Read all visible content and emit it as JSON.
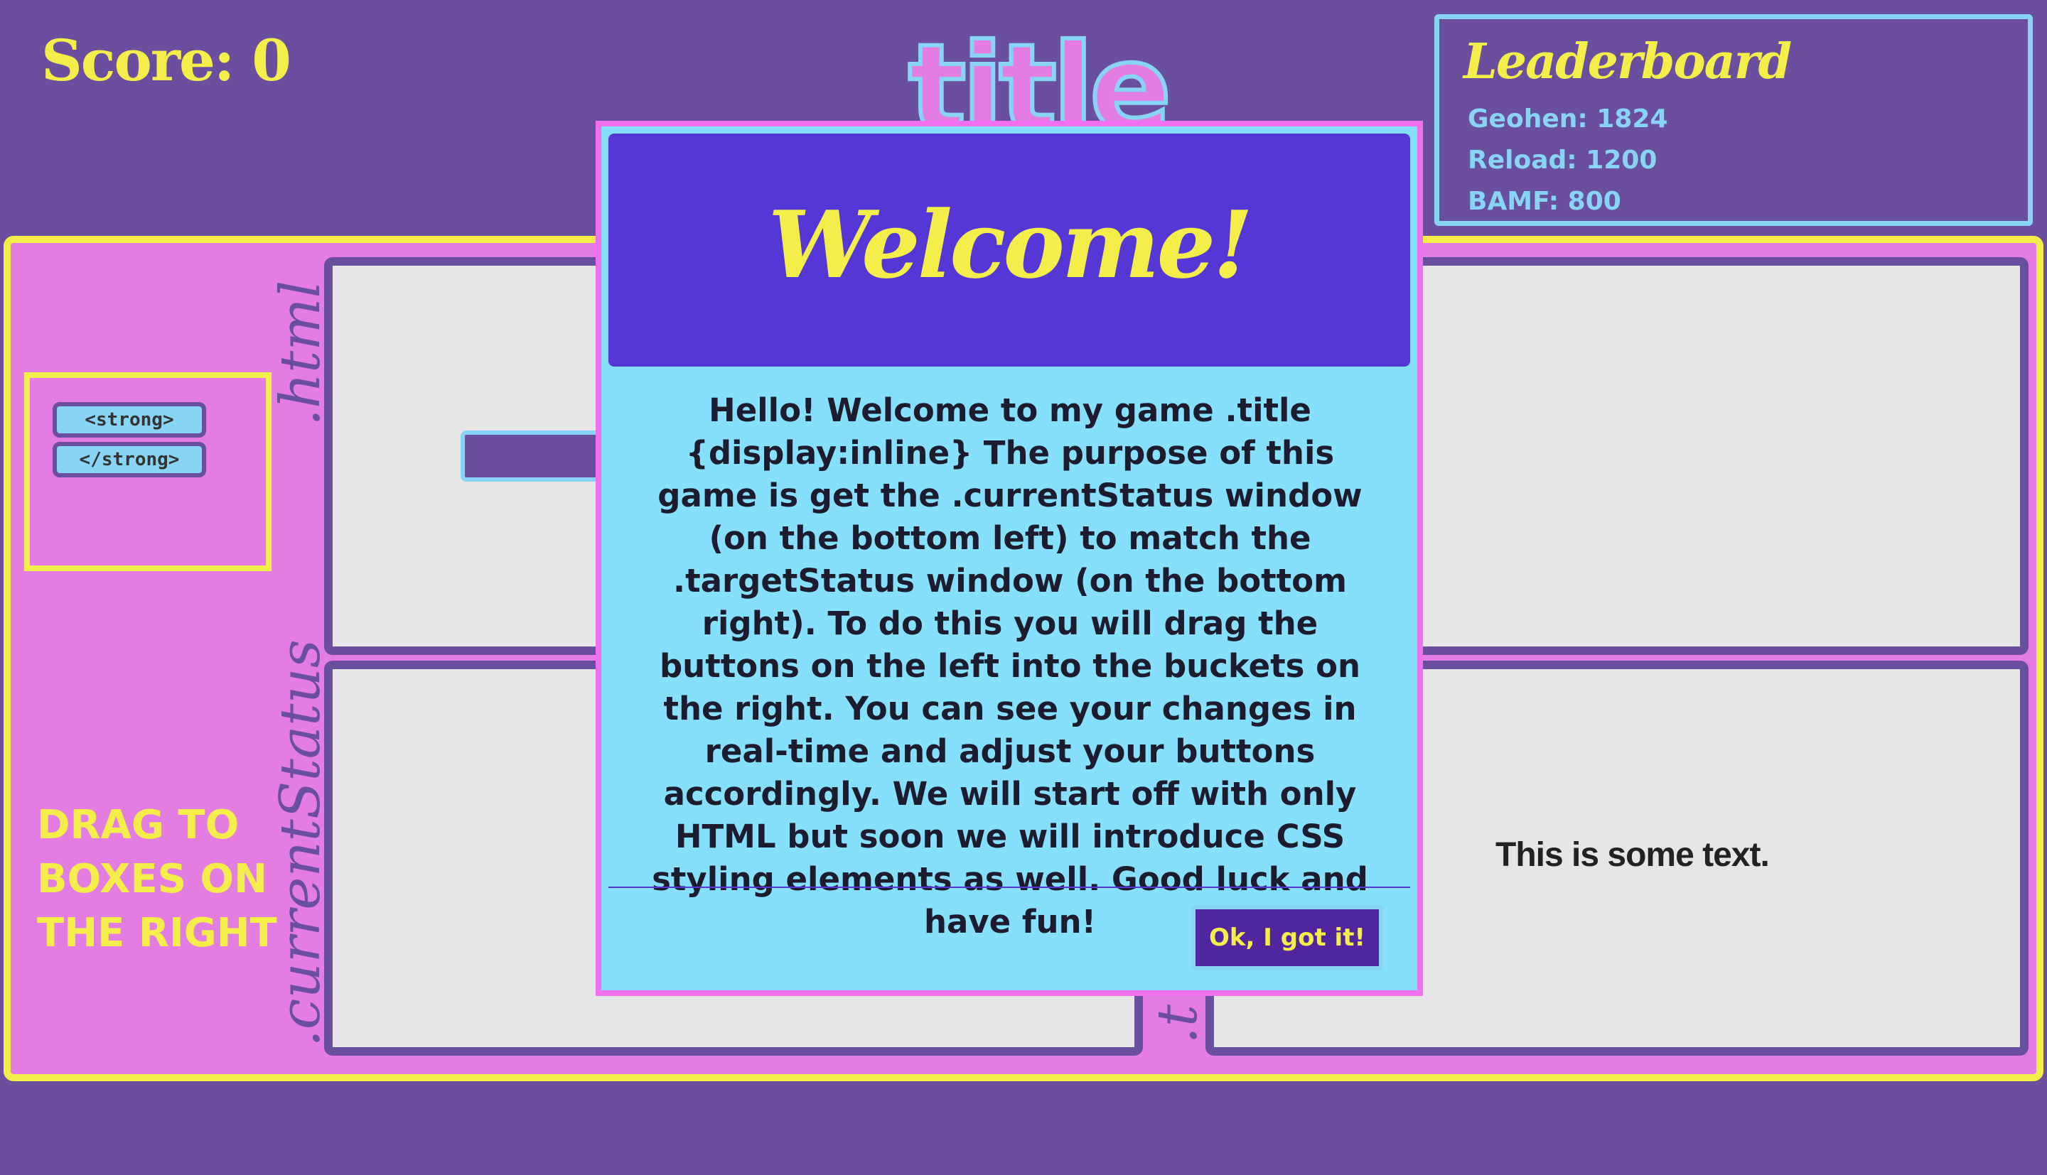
{
  "header": {
    "score_label": "Score: 0",
    "title": "title"
  },
  "leaderboard": {
    "title": "Leaderboard",
    "entries": [
      "Geohen: 1824",
      "Reload: 1200",
      "BAMF: 800"
    ]
  },
  "board": {
    "tag_buttons": [
      "<strong>",
      "</strong>"
    ],
    "label_html": ".html",
    "label_current": ".currentStatus",
    "label_target": ".t",
    "drag_hint": "DRAG TO BOXES ON THE RIGHT",
    "target_text": "This is some text."
  },
  "modal": {
    "title": "Welcome!",
    "body": "Hello! Welcome to my game .title {display:inline} The purpose of this game is get the .currentStatus window (on the bottom left) to match the .targetStatus window (on the bottom right). To do this you will drag the buttons on the left into the buckets on the right. You can see your changes in real-time and adjust your buttons accordingly. We will start off with only HTML but soon we will introduce CSS styling elements as well. Good luck and have fun!",
    "ok_label": "Ok, I got it!"
  },
  "colors": {
    "background": "#6a4f9f",
    "board": "#e47de2",
    "accent_yellow": "#f4ee4a",
    "accent_blue": "#87d4f5",
    "modal_header": "#5537d6"
  }
}
